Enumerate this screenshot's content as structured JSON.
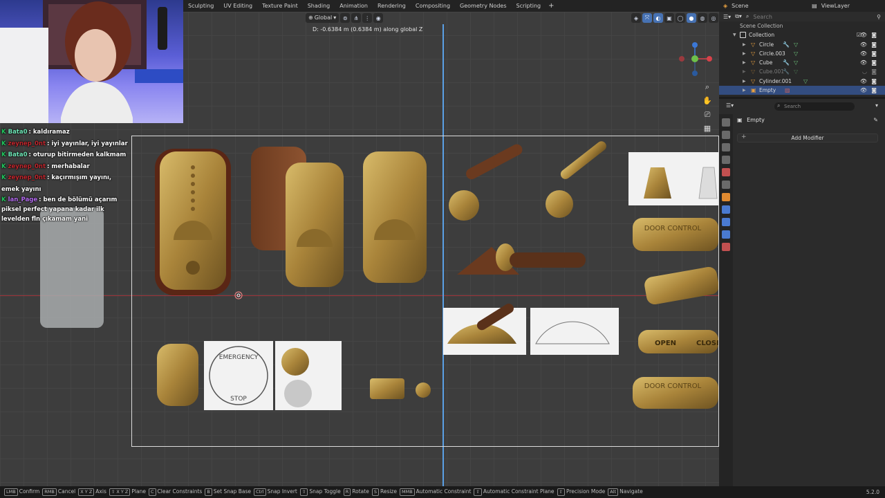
{
  "workspace_tabs": [
    "Sculpting",
    "UV Editing",
    "Texture Paint",
    "Shading",
    "Animation",
    "Rendering",
    "Compositing",
    "Geometry Nodes",
    "Scripting"
  ],
  "add_tab": "+",
  "scene": {
    "label": "Scene",
    "view_layer": "ViewLayer"
  },
  "viewport": {
    "orientation": "Global",
    "transform_readout": "D: -0.6384 m (0.6384 m) along global Z"
  },
  "chat": [
    {
      "user": "Bata0",
      "user_color": "#6ee7b7",
      "text": ": kaldıramaz"
    },
    {
      "user": "zeynep_0nt",
      "user_color": "#c0262d",
      "text": ": iyi yayınlar, iyi yayınlar"
    },
    {
      "user": "Bata0",
      "user_color": "#6ee7b7",
      "text": ": oturup bitirmeden kalkmam"
    },
    {
      "user": "zeynep_0nt",
      "user_color": "#c0262d",
      "text": ": merhabalar"
    },
    {
      "user": "zeynep_0nt",
      "user_color": "#c0262d",
      "text": ": kaçırmışım yayını, emek yayını"
    },
    {
      "user": "lan_Page",
      "user_color": "#b46cf0",
      "text": ": ben de bölümü açarım piksel perfect yapana kadar ilk levelden fln çıkamam yani"
    }
  ],
  "outliner": {
    "search_placeholder": "Search",
    "scene_collection": "Scene Collection",
    "collection": "Collection",
    "items": [
      {
        "name": "Circle",
        "dim": false,
        "selected": false
      },
      {
        "name": "Circle.003",
        "dim": false,
        "selected": false
      },
      {
        "name": "Cube",
        "dim": false,
        "selected": false
      },
      {
        "name": "Cube.001",
        "dim": true,
        "selected": false
      },
      {
        "name": "Cylinder.001",
        "dim": false,
        "selected": false
      },
      {
        "name": "Empty",
        "dim": false,
        "selected": true
      }
    ]
  },
  "properties": {
    "search_placeholder": "Search",
    "object_name": "Empty",
    "add_modifier": "Add Modifier"
  },
  "reference_labels": {
    "emergency_top": "EMERGENCY",
    "emergency_bottom": "STOP",
    "door_control": "DOOR CONTROL",
    "open": "OPEN",
    "close": "CLOSE"
  },
  "statusbar": [
    {
      "key": "LMB",
      "label": "Confirm"
    },
    {
      "key": "RMB",
      "label": "Cancel"
    },
    {
      "key": "X Y Z",
      "label": "Axis"
    },
    {
      "key": "⇧ X Y Z",
      "label": "Plane"
    },
    {
      "key": "C",
      "label": "Clear Constraints"
    },
    {
      "key": "B",
      "label": "Set Snap Base"
    },
    {
      "key": "Ctrl",
      "label": "Snap Invert"
    },
    {
      "key": "⇧",
      "label": "Snap Toggle"
    },
    {
      "key": "R",
      "label": "Rotate"
    },
    {
      "key": "S",
      "label": "Resize"
    },
    {
      "key": "MMB",
      "label": "Automatic Constraint"
    },
    {
      "key": "⇧",
      "label": "Automatic Constraint Plane"
    },
    {
      "key": "⇧",
      "label": "Precision Mode"
    },
    {
      "key": "Alt",
      "label": "Navigate"
    }
  ],
  "version": "5.2.0",
  "colors": {
    "viewport_bg": "#3d3d3d",
    "x_axis": "#a3353c",
    "z_axis": "#5aa0e6",
    "selection": "#334d80",
    "accent": "#4772b3",
    "brass": "#b9953f"
  }
}
